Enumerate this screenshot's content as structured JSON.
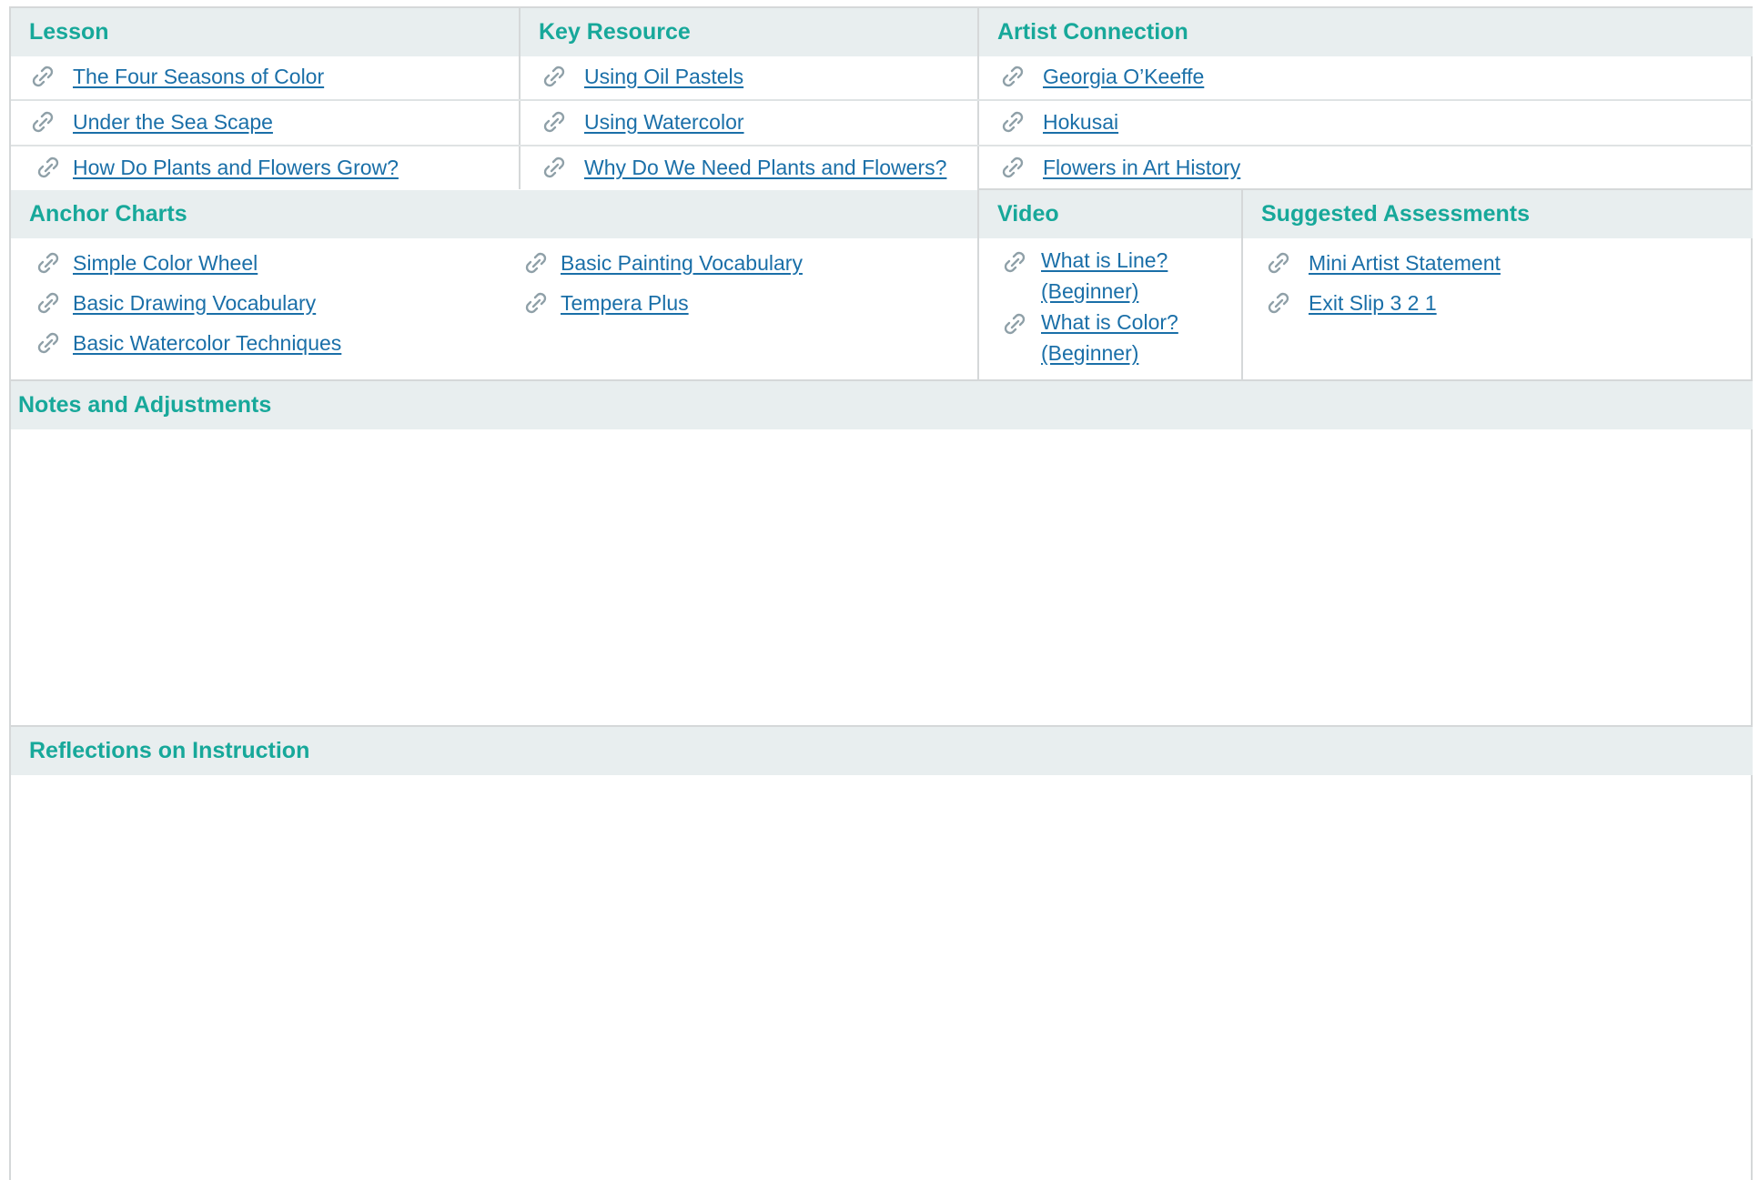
{
  "top": {
    "headers": [
      "Lesson",
      "Key Resource",
      "Artist Connection"
    ],
    "lesson": [
      "The Four Seasons of Color",
      "Under the Sea Scape",
      "How Do Plants and Flowers Grow?"
    ],
    "key_resource": [
      "Using Oil Pastels",
      "Using Watercolor",
      "Why Do We Need Plants and Flowers?"
    ],
    "artist_connection": [
      "Georgia O’Keeffe",
      "Hokusai",
      "Flowers in Art History"
    ]
  },
  "middle": {
    "anchor_charts": {
      "header": "Anchor Charts",
      "col1": [
        "Simple Color Wheel",
        "Basic Drawing Vocabulary",
        "Basic Watercolor Techniques"
      ],
      "col2": [
        "Basic Painting Vocabulary",
        "Tempera Plus"
      ]
    },
    "video": {
      "header": "Video",
      "items": [
        "What is Line? (Beginner)",
        "What is Color? (Beginner)"
      ]
    },
    "assessments": {
      "header": "Suggested Assessments",
      "items": [
        "Mini Artist Statement",
        "Exit Slip 3 2 1"
      ]
    }
  },
  "notes": {
    "header": "Notes and Adjustments"
  },
  "reflections": {
    "header": "Reflections on Instruction"
  },
  "colors": {
    "accent": "#17a89a",
    "link": "#1a6fa8",
    "header_bg": "#e8eeef"
  }
}
